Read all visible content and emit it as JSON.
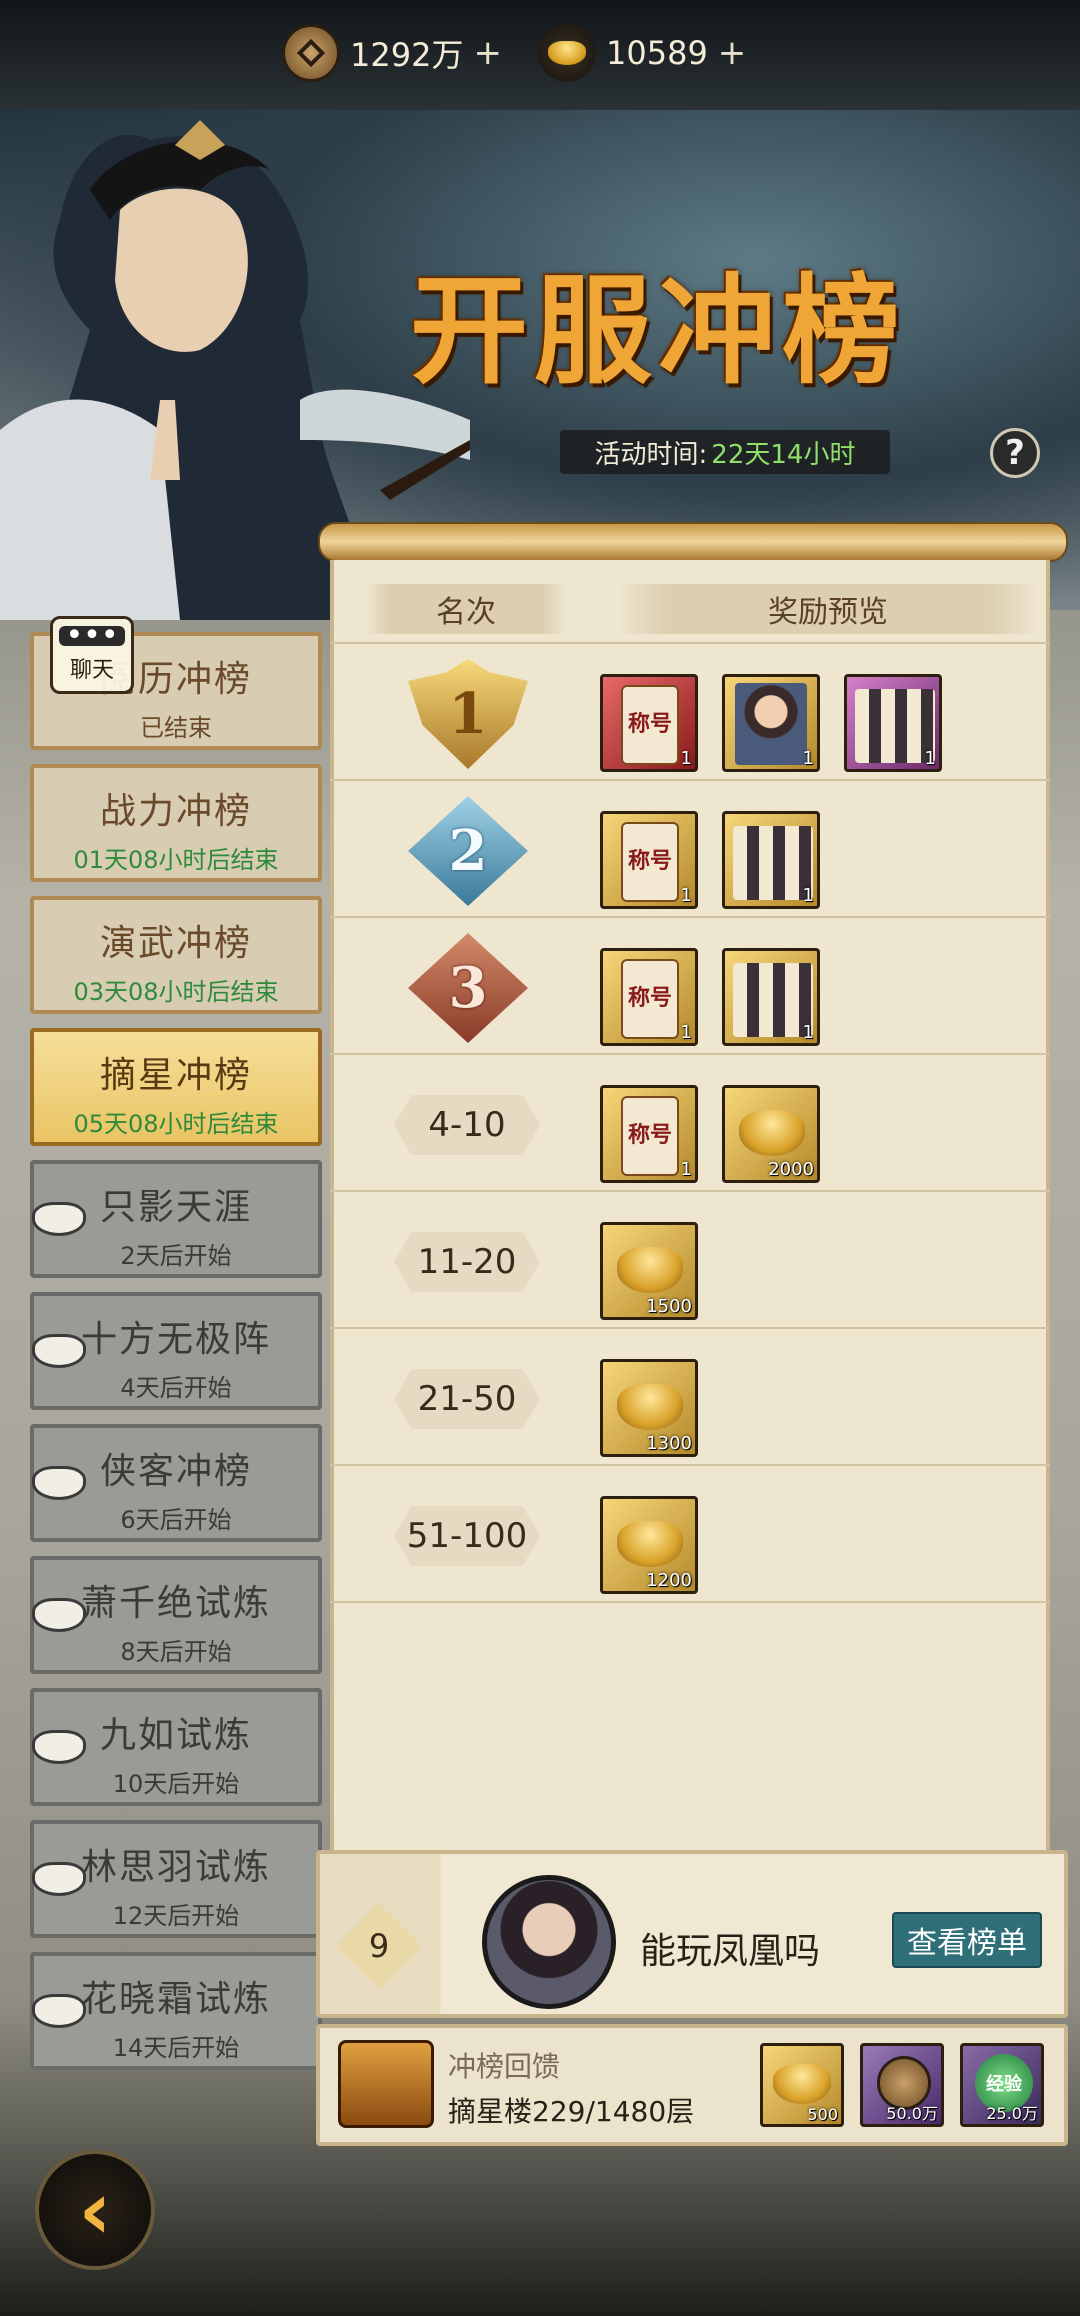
{
  "currency": {
    "coins": "1292万",
    "gold": "10589",
    "plus": "+"
  },
  "event": {
    "title": "开服冲榜",
    "time_label": "活动时间:",
    "time_value": "22天14小时",
    "help": "?"
  },
  "chat": {
    "dots": "•••",
    "label": "聊天"
  },
  "tabs": [
    {
      "name": "阅历冲榜",
      "status": "已结束",
      "state": "ended"
    },
    {
      "name": "战力冲榜",
      "status": "01天08小时后结束",
      "state": "active"
    },
    {
      "name": "演武冲榜",
      "status": "03天08小时后结束",
      "state": "active"
    },
    {
      "name": "摘星冲榜",
      "status": "05天08小时后结束",
      "state": "selected"
    },
    {
      "name": "只影天涯",
      "status": "2天后开始",
      "state": "locked"
    },
    {
      "name": "十方无极阵",
      "status": "4天后开始",
      "state": "locked"
    },
    {
      "name": "侠客冲榜",
      "status": "6天后开始",
      "state": "locked"
    },
    {
      "name": "萧千绝试炼",
      "status": "8天后开始",
      "state": "locked"
    },
    {
      "name": "九如试炼",
      "status": "10天后开始",
      "state": "locked"
    },
    {
      "name": "林思羽试炼",
      "status": "12天后开始",
      "state": "locked"
    },
    {
      "name": "花晓霜试炼",
      "status": "14天后开始",
      "state": "locked"
    }
  ],
  "table": {
    "col_rank": "名次",
    "col_reward": "奖励预览",
    "rows": [
      {
        "rank": "1",
        "rewards": [
          {
            "type": "title-scroll",
            "count": "1",
            "symbol": "称号"
          },
          {
            "type": "hero-card",
            "count": "1"
          },
          {
            "type": "card-pack",
            "count": "1"
          }
        ]
      },
      {
        "rank": "2",
        "rewards": [
          {
            "type": "title-scroll",
            "count": "1",
            "symbol": "称号"
          },
          {
            "type": "card-pack",
            "count": "1"
          }
        ]
      },
      {
        "rank": "3",
        "rewards": [
          {
            "type": "title-scroll",
            "count": "1",
            "symbol": "称号"
          },
          {
            "type": "card-pack",
            "count": "1"
          }
        ]
      },
      {
        "rank": "4-10",
        "rewards": [
          {
            "type": "title-scroll",
            "count": "1",
            "symbol": "称号"
          },
          {
            "type": "gold-ingot",
            "count": "2000"
          }
        ]
      },
      {
        "rank": "11-20",
        "rewards": [
          {
            "type": "gold-ingot",
            "count": "1500"
          }
        ]
      },
      {
        "rank": "21-50",
        "rewards": [
          {
            "type": "gold-ingot",
            "count": "1300"
          }
        ]
      },
      {
        "rank": "51-100",
        "rewards": [
          {
            "type": "gold-ingot",
            "count": "1200"
          }
        ]
      }
    ]
  },
  "my_rank": {
    "rank": "9",
    "player": "能玩凤凰吗",
    "view_button": "查看榜单"
  },
  "feedback": {
    "title": "冲榜回馈",
    "progress": "摘星楼229/1480层",
    "rewards": [
      {
        "type": "gold-ingot",
        "count": "500"
      },
      {
        "type": "coin",
        "count": "50.0万"
      },
      {
        "type": "exp",
        "count": "25.0万",
        "symbol": "经验"
      }
    ]
  },
  "back": "‹"
}
